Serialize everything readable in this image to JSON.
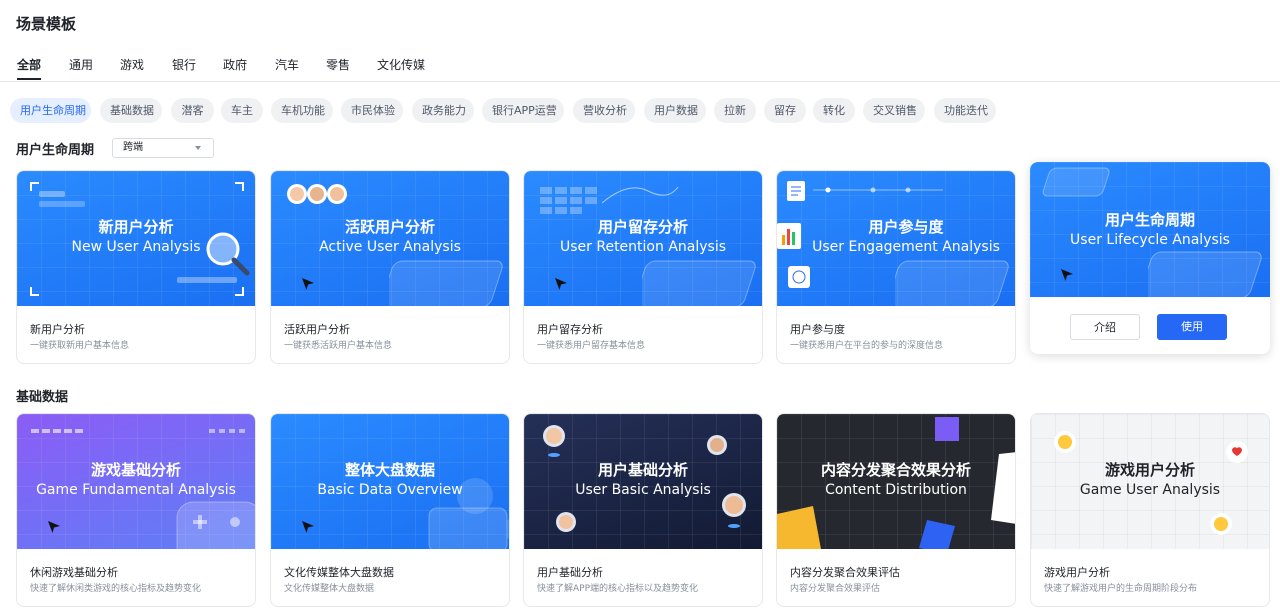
{
  "page": {
    "title": "场景模板"
  },
  "tabs": [
    {
      "label": "全部",
      "active": true
    },
    {
      "label": "通用"
    },
    {
      "label": "游戏"
    },
    {
      "label": "银行"
    },
    {
      "label": "政府"
    },
    {
      "label": "汽车"
    },
    {
      "label": "零售"
    },
    {
      "label": "文化传媒"
    }
  ],
  "chips": [
    {
      "label": "用户生命周期",
      "active": true
    },
    {
      "label": "基础数据"
    },
    {
      "label": "潜客"
    },
    {
      "label": "车主"
    },
    {
      "label": "车机功能"
    },
    {
      "label": "市民体验"
    },
    {
      "label": "政务能力"
    },
    {
      "label": "银行APP运营"
    },
    {
      "label": "营收分析"
    },
    {
      "label": "用户数据"
    },
    {
      "label": "拉新"
    },
    {
      "label": "留存"
    },
    {
      "label": "转化"
    },
    {
      "label": "交叉销售"
    },
    {
      "label": "功能迭代"
    }
  ],
  "sections": [
    {
      "title": "用户生命周期",
      "platform_select": "跨端",
      "cards": [
        {
          "banner_cn": "新用户分析",
          "banner_en": "New User Analysis",
          "name": "新用户分析",
          "desc": "一键获取新用户基本信息"
        },
        {
          "banner_cn": "活跃用户分析",
          "banner_en": "Active User Analysis",
          "name": "活跃用户分析",
          "desc": "一键获悉活跃用户基本信息"
        },
        {
          "banner_cn": "用户留存分析",
          "banner_en": "User Retention Analysis",
          "name": "用户留存分析",
          "desc": "一键获悉用户留存基本信息"
        },
        {
          "banner_cn": "用户参与度",
          "banner_en": "User Engagement Analysis",
          "name": "用户参与度",
          "desc": "一键获悉用户在平台的参与的深度信息"
        },
        {
          "banner_cn": "用户生命周期",
          "banner_en": "User Lifecycle Analysis",
          "intro_button": "介绍",
          "use_button": "使用"
        }
      ]
    },
    {
      "title": "基础数据",
      "cards": [
        {
          "banner_cn": "游戏基础分析",
          "banner_en": "Game Fundamental Analysis",
          "name": "休闲游戏基础分析",
          "desc": "快速了解休闲类游戏的核心指标及趋势变化"
        },
        {
          "banner_cn": "整体大盘数据",
          "banner_en": "Basic Data Overview",
          "name": "文化传媒整体大盘数据",
          "desc": "文化传媒整体大盘数据"
        },
        {
          "banner_cn": "用户基础分析",
          "banner_en": "User Basic Analysis",
          "name": "用户基础分析",
          "desc": "快速了解APP端的核心指标以及趋势变化"
        },
        {
          "banner_cn": "内容分发聚合效果分析",
          "banner_en": "Content Distribution",
          "name": "内容分发聚合效果评估",
          "desc": "内容分发聚合效果评估"
        },
        {
          "banner_cn": "游戏用户分析",
          "banner_en": "Game User Analysis",
          "name": "游戏用户分析",
          "desc": "快速了解游戏用户的生命周期阶段分布"
        }
      ]
    }
  ],
  "colors": {
    "accent": "#2568f5",
    "chip_active_bg": "#e6efff",
    "banner_blue": "#1f7bff"
  }
}
